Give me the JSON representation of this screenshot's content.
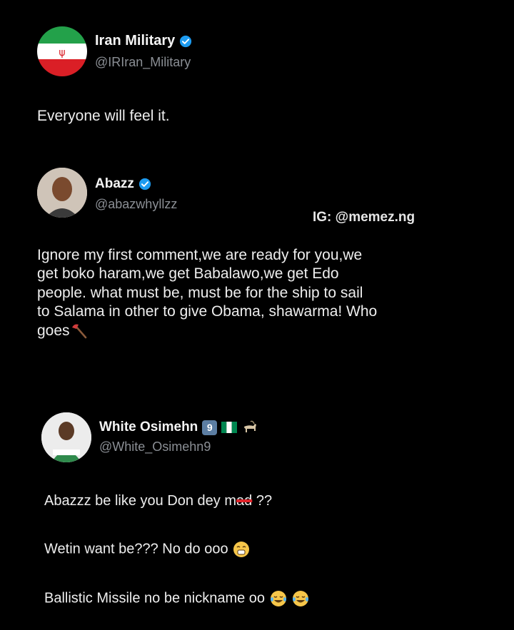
{
  "post1": {
    "display_name": "Iran Military",
    "handle": "@IRIran_Military",
    "text": "Everyone will feel it.",
    "avatar_icon": "iran-flag-icon",
    "verified_icon": "verified-badge-icon"
  },
  "post2": {
    "display_name": "Abazz",
    "handle": "@abazwhyllzz",
    "watermark": "IG: @memez.ng",
    "text_lines": [
      "Ignore my first comment,we are ready for you,we",
      "get boko haram,we get Babalawo,we get Edo",
      "people. what must be, must be for the ship to sail",
      "to Salama in other to give Obama, shawarma! Who",
      "goes"
    ],
    "trailing_icon": "axe-emoji-icon",
    "verified_icon": "verified-badge-icon"
  },
  "post3": {
    "display_name": "White Osimehn",
    "badge_number": "9",
    "handle": "@White_Osimehn9",
    "line1_prefix": "Abazzz be like you Don dey m",
    "line1_struck": "ad",
    "line1_suffix": " ??",
    "line2": "Wetin want be??? No do ooo",
    "line3": "Ballistic Missile no be nickname oo",
    "name_icons": [
      "keycap-9-icon",
      "nigeria-flag-icon",
      "goat-emoji-icon"
    ]
  },
  "colors": {
    "background": "#000000",
    "text": "#f2f2f2",
    "handle": "#8b8f95",
    "verified": "#1d9bf0"
  }
}
